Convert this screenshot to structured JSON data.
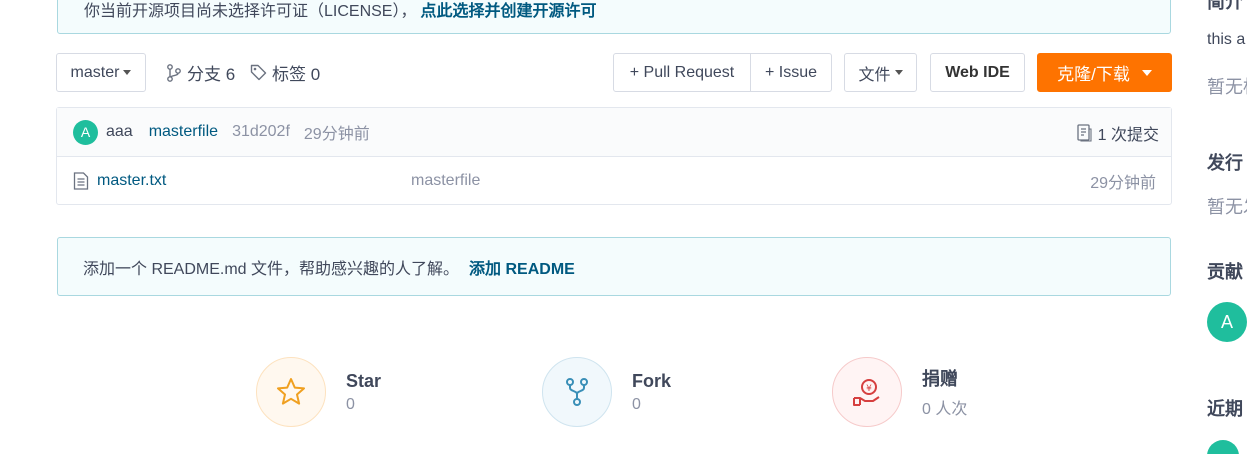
{
  "license_banner": {
    "text": "你当前开源项目尚未选择许可证（LICENSE），",
    "link": "点此选择并创建开源许可"
  },
  "toolbar": {
    "branch": "master",
    "branches_label": "分支 6",
    "tags_label": "标签 0",
    "pull_request": "+ Pull Request",
    "issue": "+ Issue",
    "file": "文件",
    "web_ide": "Web IDE",
    "clone": "克隆/下载"
  },
  "commit": {
    "avatar": "A",
    "author": "aaa",
    "message": "masterfile",
    "sha": "31d202f",
    "time": "29分钟前",
    "count": "1 次提交"
  },
  "files": [
    {
      "name": "master.txt",
      "message": "masterfile",
      "time": "29分钟前"
    }
  ],
  "readme_banner": {
    "text": "添加一个 README.md 文件，帮助感兴趣的人了解。",
    "link": "添加 README"
  },
  "stats": {
    "star": {
      "label": "Star",
      "value": "0"
    },
    "fork": {
      "label": "Fork",
      "value": "0"
    },
    "donate": {
      "label": "捐赠",
      "value": "0 人次"
    }
  },
  "sidebar": {
    "intro_head": "简介",
    "intro_text": "this a",
    "intro_muted": "暂无标",
    "release_head": "发行",
    "release_muted": "暂无发",
    "contrib_head": "贡献",
    "contrib_avatar": "A",
    "recent_head": "近期"
  },
  "colors": {
    "accent": "#fe7300",
    "link": "#005980",
    "banner_bg": "#f4fcfd",
    "banner_border": "#a9d8e0",
    "avatar": "#1fbe9d"
  }
}
